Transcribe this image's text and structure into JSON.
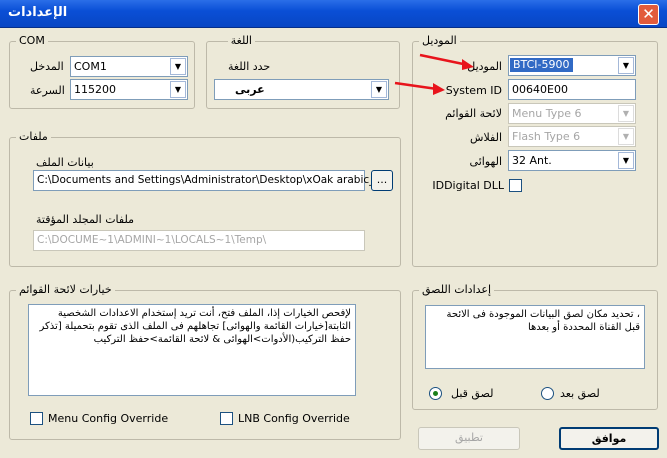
{
  "window": {
    "title": "الإعدادات",
    "close": "✕"
  },
  "com": {
    "legend": "COM",
    "port_label": "المدخل",
    "port_value": "COM1",
    "speed_label": "السرعة",
    "speed_value": "115200"
  },
  "language": {
    "legend": "اللغة",
    "select_label": "حدد اللغة",
    "value": "عربى"
  },
  "model": {
    "legend": "الموديل",
    "model_label": "الموديل",
    "model_value": "BTCI-5900",
    "system_id_label": "System ID",
    "system_id_value": "00640E00",
    "menu_list_label": "لائحة القوائم",
    "menu_list_value": "Menu Type 6",
    "flash_label": "الفلاش",
    "flash_value": "Flash Type 6",
    "antenna_label": "الهوائى",
    "antenna_value": "32 Ant.",
    "iddigital_label": "IDDigital DLL"
  },
  "files": {
    "legend": "ملفات",
    "file_data_label": "بيانات الملف",
    "file_path": "C:\\Documents and Settings\\Administrator\\Desktop\\xOak arabic_",
    "browse": "...",
    "temp_label": "ملفات المجلد المؤقتة",
    "temp_path": "C:\\DOCUME~1\\ADMINI~1\\LOCALS~1\\Temp\\"
  },
  "menu_options": {
    "legend": "خيارات لائحة القوائم",
    "description": "لإفحص الخيارات إذا، الملف فتح، أنت تريد إستخدام الاعدادات الشخصية الثابتة[خيارات القائمة والهوائى] تجاهلهم فى الملف الذى تقوم بتحميلة [تذكر حفظ التركيب(الأدوات>الهوائى & لائحة القائمة>حفظ التركيب",
    "menu_override": "Menu Config Override",
    "lnb_override": "LNB Config Override"
  },
  "paste": {
    "legend": "إعدادات اللصق",
    "description": "، تحديد مكان لصق البيانات الموجودة فى الائحة قبل القناة المحددة أو بعدها",
    "after_label": "لصق بعد",
    "before_label": "لصق قبل",
    "selected": "before"
  },
  "buttons": {
    "apply": "تطبيق",
    "ok": "موافق"
  },
  "colors": {
    "title_bar": "#0a4fd6",
    "annotation_arrow": "#e8141c",
    "selection": "#316ac5"
  },
  "icons": {
    "dropdown": "▼",
    "close": "close-icon"
  }
}
